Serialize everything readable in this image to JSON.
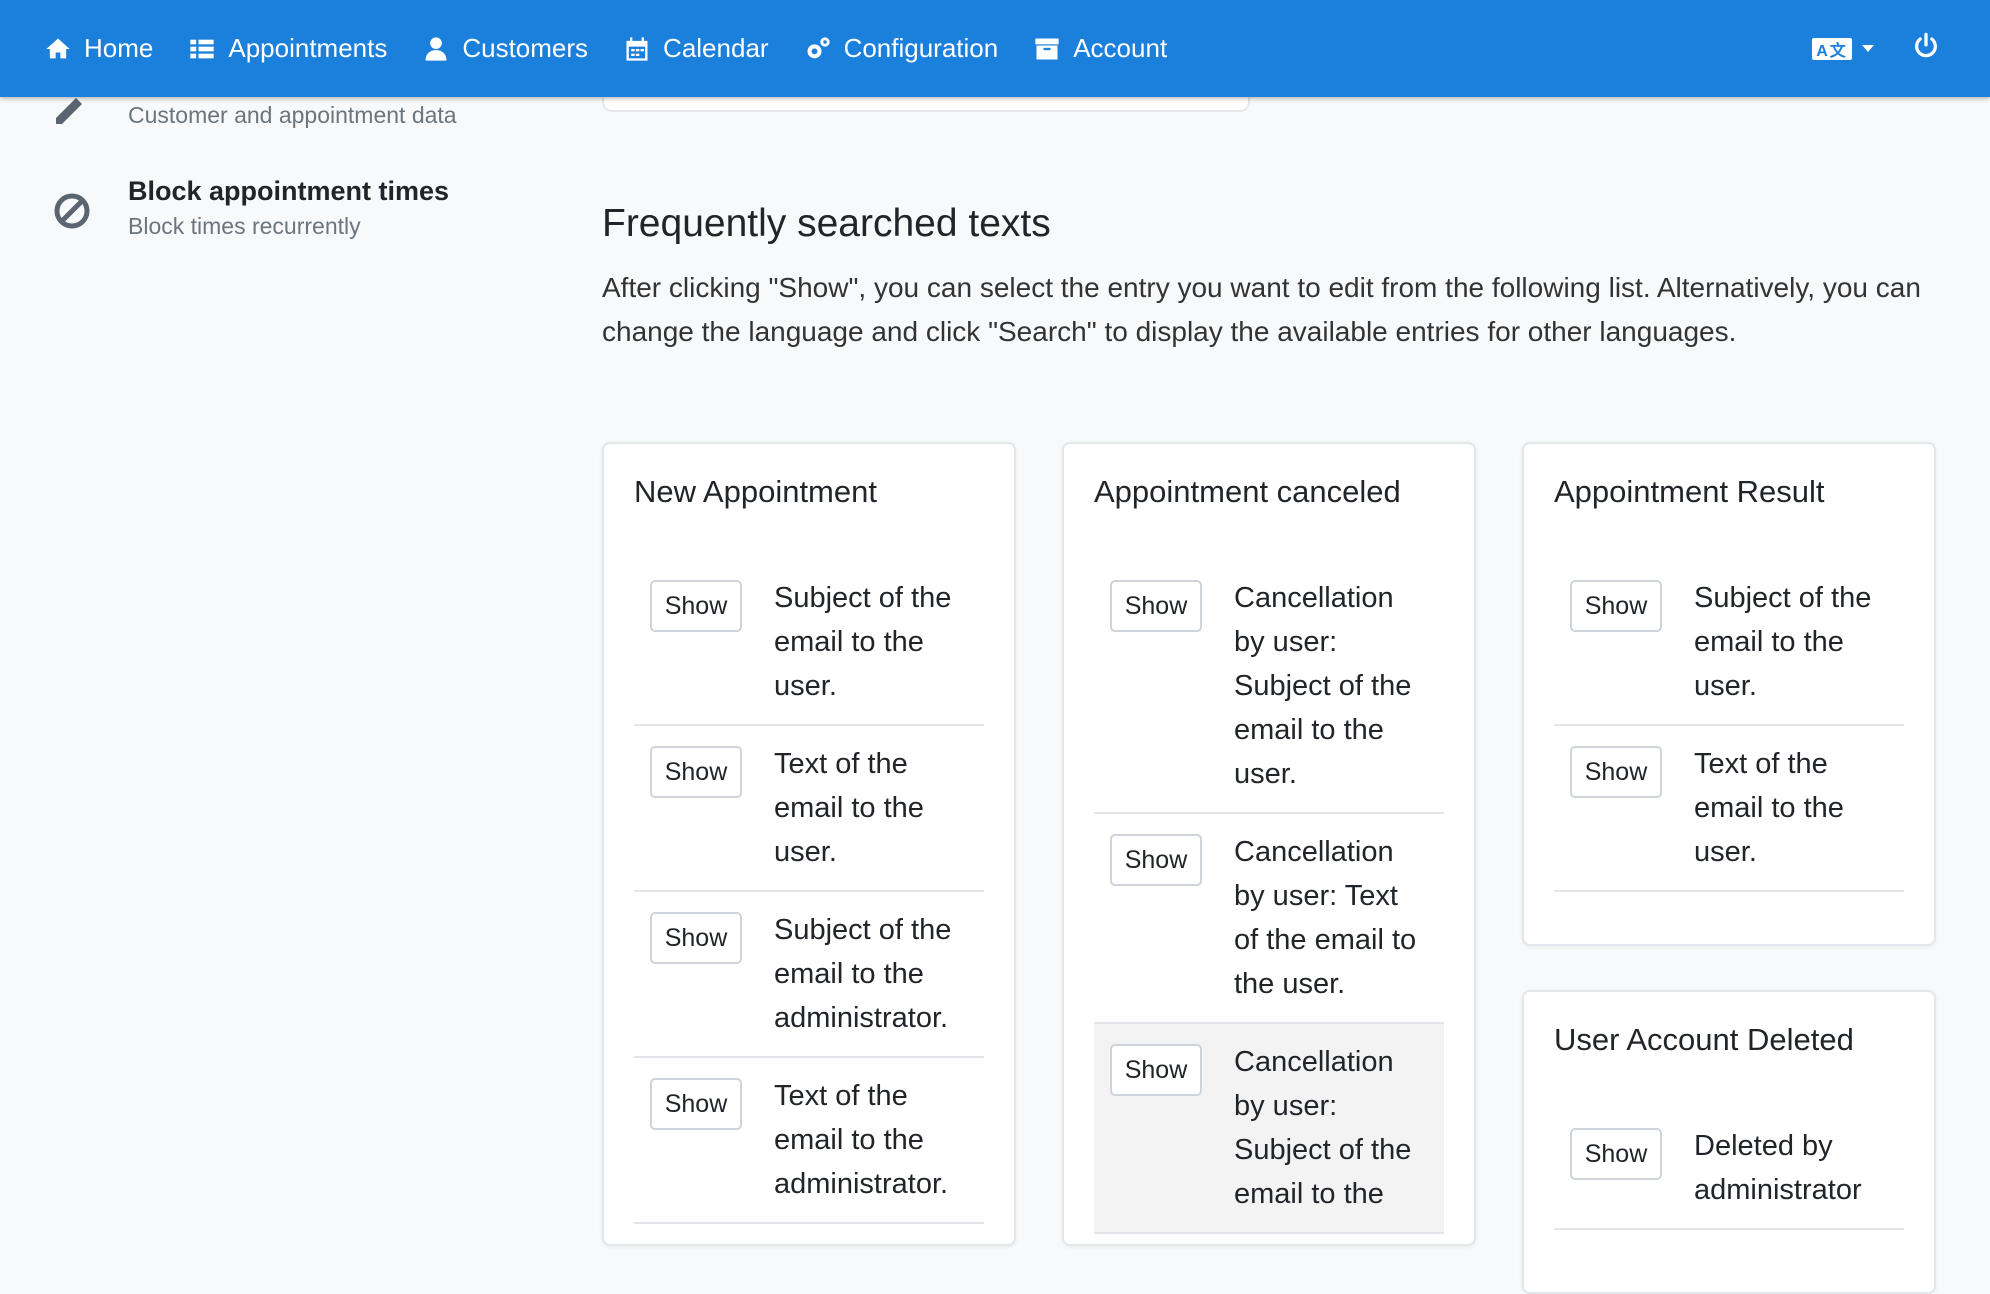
{
  "nav": {
    "items": [
      {
        "label": "Home",
        "icon": "home-icon"
      },
      {
        "label": "Appointments",
        "icon": "list-icon"
      },
      {
        "label": "Customers",
        "icon": "user-icon"
      },
      {
        "label": "Calendar",
        "icon": "calendar-icon"
      },
      {
        "label": "Configuration",
        "icon": "cogs-icon"
      },
      {
        "label": "Account",
        "icon": "archive-icon"
      }
    ],
    "language_icon": "language-icon",
    "logout_icon": "power-icon",
    "accent_color": "#1b7fdc"
  },
  "sidebar": {
    "items": [
      {
        "title": "",
        "subtitle": "Customer and appointment data",
        "icon": "pencil-icon"
      },
      {
        "title": "Block appointment times",
        "subtitle": "Block times recurrently",
        "icon": "ban-icon"
      }
    ]
  },
  "main": {
    "title": "Frequently searched texts",
    "description": "After clicking \"Show\", you can select the entry you want to edit from the following list. Alternatively, you can change the language and click \"Search\" to display the available entries for other languages.",
    "cards": [
      {
        "title": "New Appointment",
        "rows": [
          {
            "button": "Show",
            "text": "Subject of the email to the user."
          },
          {
            "button": "Show",
            "text": "Text of the email to the user."
          },
          {
            "button": "Show",
            "text": "Subject of the email to the administrator."
          },
          {
            "button": "Show",
            "text": "Text of the email to the administrator."
          }
        ]
      },
      {
        "title": "Appointment canceled",
        "rows": [
          {
            "button": "Show",
            "text": "Cancellation by user: Subject of the email to the user."
          },
          {
            "button": "Show",
            "text": "Cancellation by user: Text of the email to the user."
          },
          {
            "button": "Show",
            "text": "Cancellation by user: Subject of the email to the"
          }
        ]
      },
      {
        "title": "Appointment Result",
        "rows": [
          {
            "button": "Show",
            "text": "Subject of the email to the user."
          },
          {
            "button": "Show",
            "text": "Text of the email to the user."
          }
        ]
      },
      {
        "title": "User Account Deleted",
        "rows": [
          {
            "button": "Show",
            "text": "Deleted by administrator"
          }
        ]
      }
    ]
  }
}
